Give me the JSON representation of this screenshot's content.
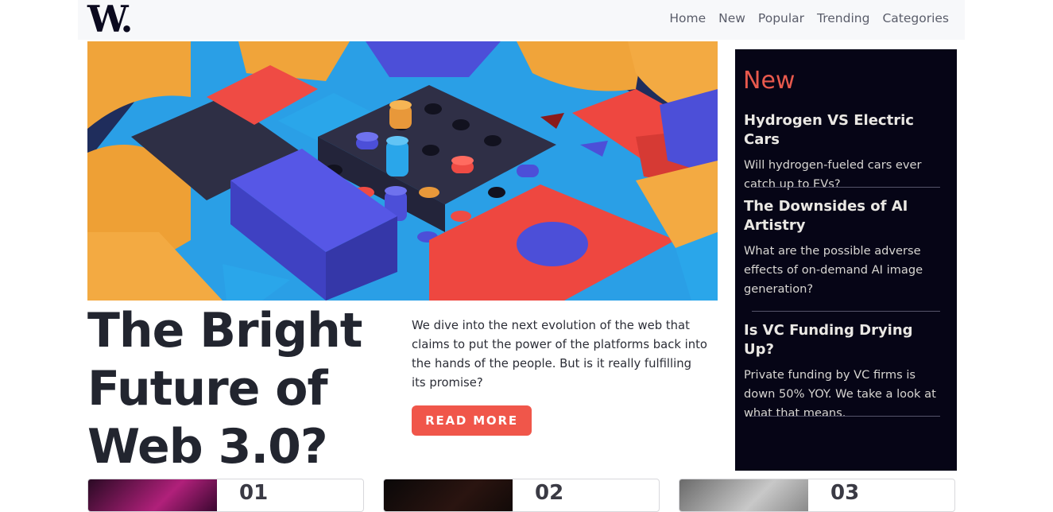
{
  "header": {
    "logo": "W.",
    "nav": [
      "Home",
      "New",
      "Popular",
      "Trending",
      "Categories"
    ]
  },
  "hero": {
    "title": "The Bright Future of Web 3.0?",
    "description": "We dive into the next evolution of the web that claims to put the power of the platforms back into the hands of the people. But is it really fulfilling its promise?",
    "cta": "READ MORE"
  },
  "sidebar": {
    "heading": "New",
    "items": [
      {
        "title": "Hydrogen VS Electric Cars",
        "description": "Will hydrogen-fueled cars ever catch up to EVs?"
      },
      {
        "title": "The Downsides of AI Artistry",
        "description": "What are the possible adverse effects of on-demand AI image generation?"
      },
      {
        "title": "Is VC Funding Drying Up?",
        "description": "Private funding by VC firms is down 50% YOY. We take a look at what that means."
      }
    ]
  },
  "cards": [
    {
      "number": "01"
    },
    {
      "number": "02"
    },
    {
      "number": "03"
    }
  ],
  "colors": {
    "accent": "#f0564a",
    "sidebar_bg": "#060516",
    "heading_text": "#22252f"
  }
}
